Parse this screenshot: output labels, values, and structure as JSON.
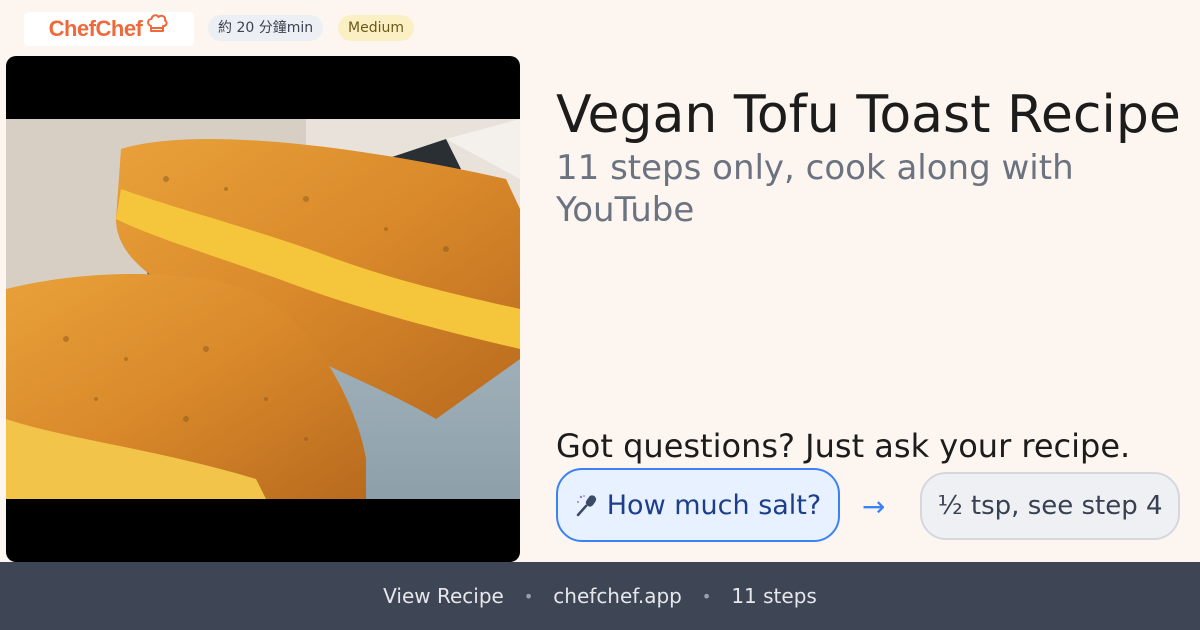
{
  "brand": {
    "name": "ChefChef",
    "logo_icon": "chef-hat-icon",
    "color": "#ef6a3a"
  },
  "meta": {
    "time": "約 20 分鐘min",
    "difficulty": "Medium"
  },
  "recipe": {
    "title": "Vegan Tofu Toast Recipe",
    "subtitle": "11 steps only, cook along with YouTube",
    "image_icon": "tofu-toast-photo"
  },
  "qa": {
    "heading": "Got questions? Just ask your recipe.",
    "question_icon": "microphone-icon",
    "question": "How much salt?",
    "arrow": "→",
    "answer": "½ tsp, see step 4",
    "accent": "#3b82f6"
  },
  "footer": {
    "view_recipe": "View Recipe",
    "separator": "•",
    "site": "chefchef.app",
    "steps": "11 steps",
    "background": "#3e4554"
  }
}
